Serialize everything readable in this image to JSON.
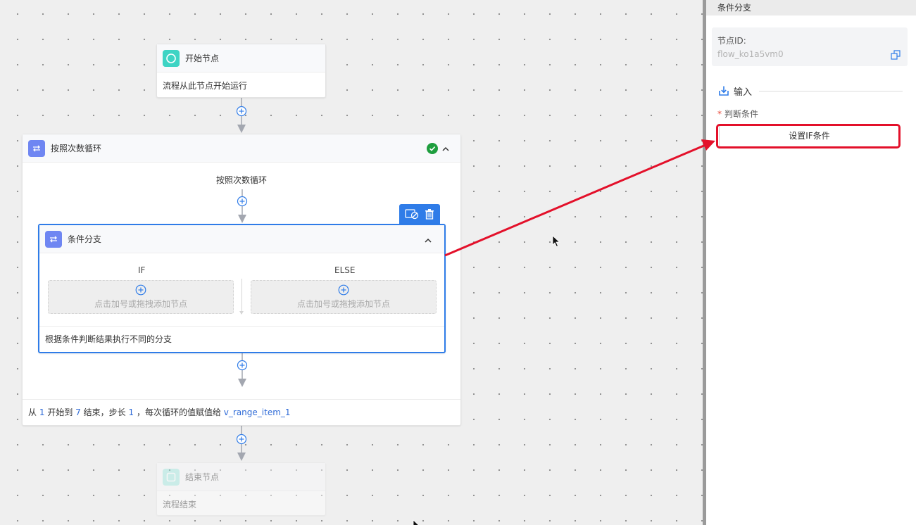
{
  "panel": {
    "header_title": "条件分支",
    "node_id_label": "节点ID:",
    "node_id_value": "flow_ko1a5vm0",
    "input_section_title": "输入",
    "required_mark": "*",
    "condition_label": "判断条件",
    "set_if_button": "设置IF条件"
  },
  "flow": {
    "start_node": {
      "title": "开始节点",
      "description": "流程从此节点开始运行"
    },
    "loop_node": {
      "title": "按照次数循环",
      "center_label": "按照次数循环",
      "footer": {
        "from_text": "从",
        "start_value": "1",
        "start_to_text": "开始到",
        "end_value": "7",
        "end_text": "结束，步长",
        "step_value": "1",
        "assign_text": "，每次循环的值赋值给",
        "variable": "v_range_item_1"
      }
    },
    "condition_node": {
      "title": "条件分支",
      "if_label": "IF",
      "else_label": "ELSE",
      "add_hint": "点击加号或拖拽添加节点",
      "description": "根据条件判断结果执行不同的分支"
    },
    "end_node": {
      "title": "结束节点",
      "description": "流程结束"
    }
  },
  "colors": {
    "accent_blue": "#2f7ce8",
    "start_icon": "#3ed4c4",
    "loop_icon": "#6f86f2",
    "success_green": "#1e9e3e",
    "annotation_red": "#e3102a"
  }
}
